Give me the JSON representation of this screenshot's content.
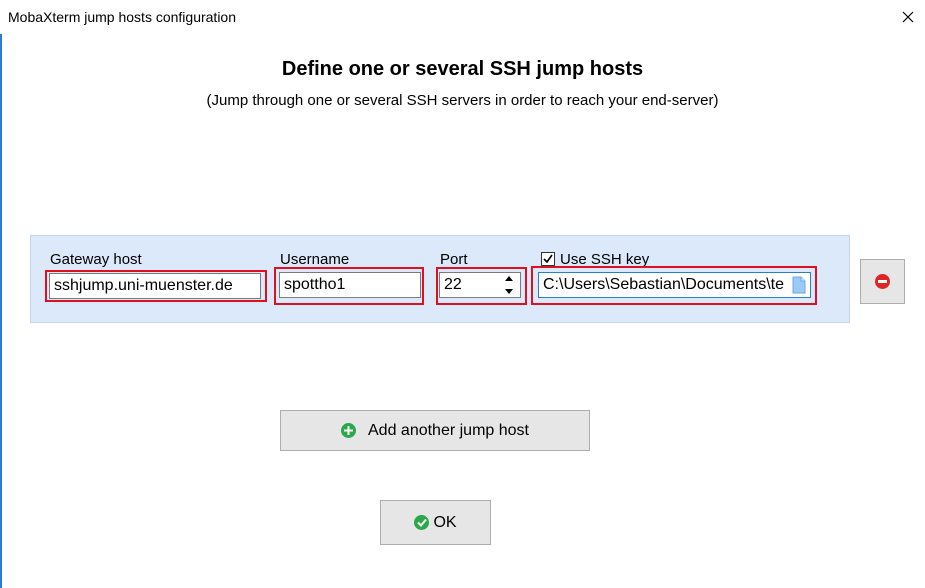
{
  "window": {
    "title": "MobaXterm jump hosts configuration",
    "close_glyph": "✕"
  },
  "header": {
    "title": "Define one or several SSH jump hosts",
    "subtitle": "(Jump through one or several SSH servers in order to reach your end-server)"
  },
  "jump_host": {
    "gateway_label": "Gateway host",
    "gateway_value": "sshjump.uni-muenster.de",
    "username_label": "Username",
    "username_value": "spottho1",
    "port_label": "Port",
    "port_value": "22",
    "ssh_key_label": "Use SSH key",
    "ssh_key_checked": true,
    "ssh_key_value": "C:\\Users\\Sebastian\\Documents\\te"
  },
  "buttons": {
    "add_label": "Add another jump host",
    "ok_label": "OK"
  },
  "colors": {
    "accent_blue": "#2b7cd3",
    "panel_bg": "#dbe9fb",
    "highlight_red": "#e0101e",
    "remove_red": "#e02424",
    "add_green": "#2aa84a"
  },
  "icons": {
    "close": "close-icon",
    "remove": "remove-icon",
    "add": "add-icon",
    "ok": "check-icon",
    "file": "file-icon",
    "checkbox": "checkmark-icon"
  }
}
